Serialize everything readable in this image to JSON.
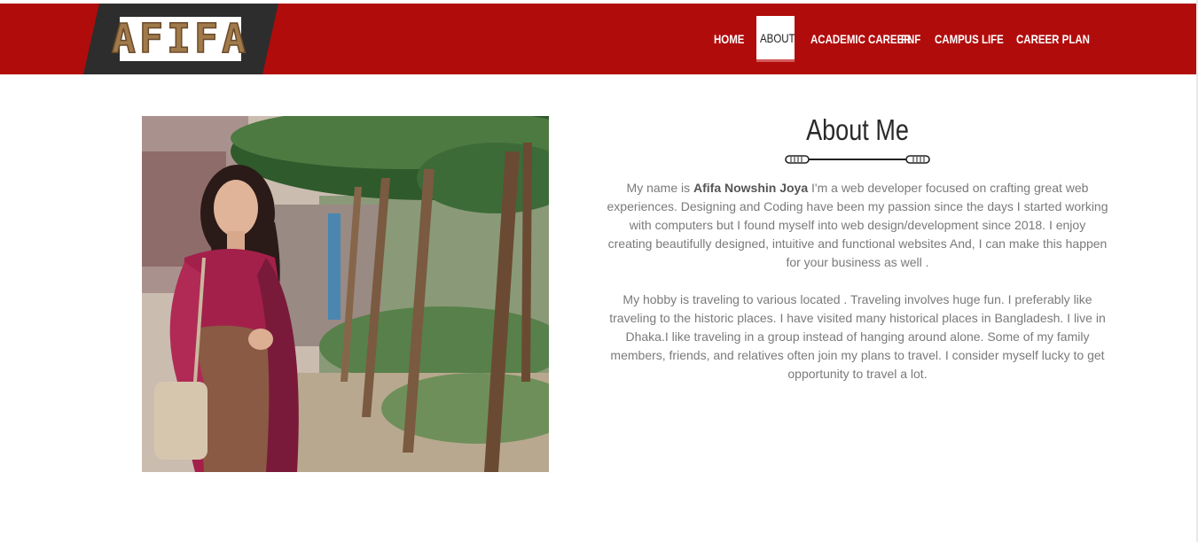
{
  "header": {
    "logo_text": "AFIFA",
    "colors": {
      "header_bg": "#b10c0c",
      "logo_band": "#2d2d2d",
      "logo_text": "#a07a4a"
    },
    "nav": [
      {
        "label": "HOME",
        "active": false
      },
      {
        "label": "ABOUT",
        "active": true
      },
      {
        "label": "ACADEMIC CAREER",
        "active": false
      },
      {
        "label": "FNF",
        "active": false
      },
      {
        "label": "CAMPUS LIFE",
        "active": false
      },
      {
        "label": "CAREER PLAN",
        "active": false
      }
    ]
  },
  "about": {
    "title": "About Me",
    "p1_intro": "My name is",
    "p1_name": "Afifa Nowshin Joya",
    "p1_rest": "I'm a web developer focused on crafting great web experiences. Designing and Coding have been my passion since the days I started working with computers but I found myself into web design/development since 2018. I enjoy creating beautifully designed, intuitive and functional websites And, I can make this happen for your business as well .",
    "p2": "My hobby is traveling to various located . Traveling involves huge fun. I preferably like traveling to the historic places. I have visited many historical places in Bangladesh. I live in Dhaka.I like traveling in a group instead of hanging around alone. Some of my family members, friends, and relatives often join my plans to travel. I consider myself lucky to get opportunity to travel a lot."
  },
  "photo": {
    "icon": "portrait-photo"
  }
}
